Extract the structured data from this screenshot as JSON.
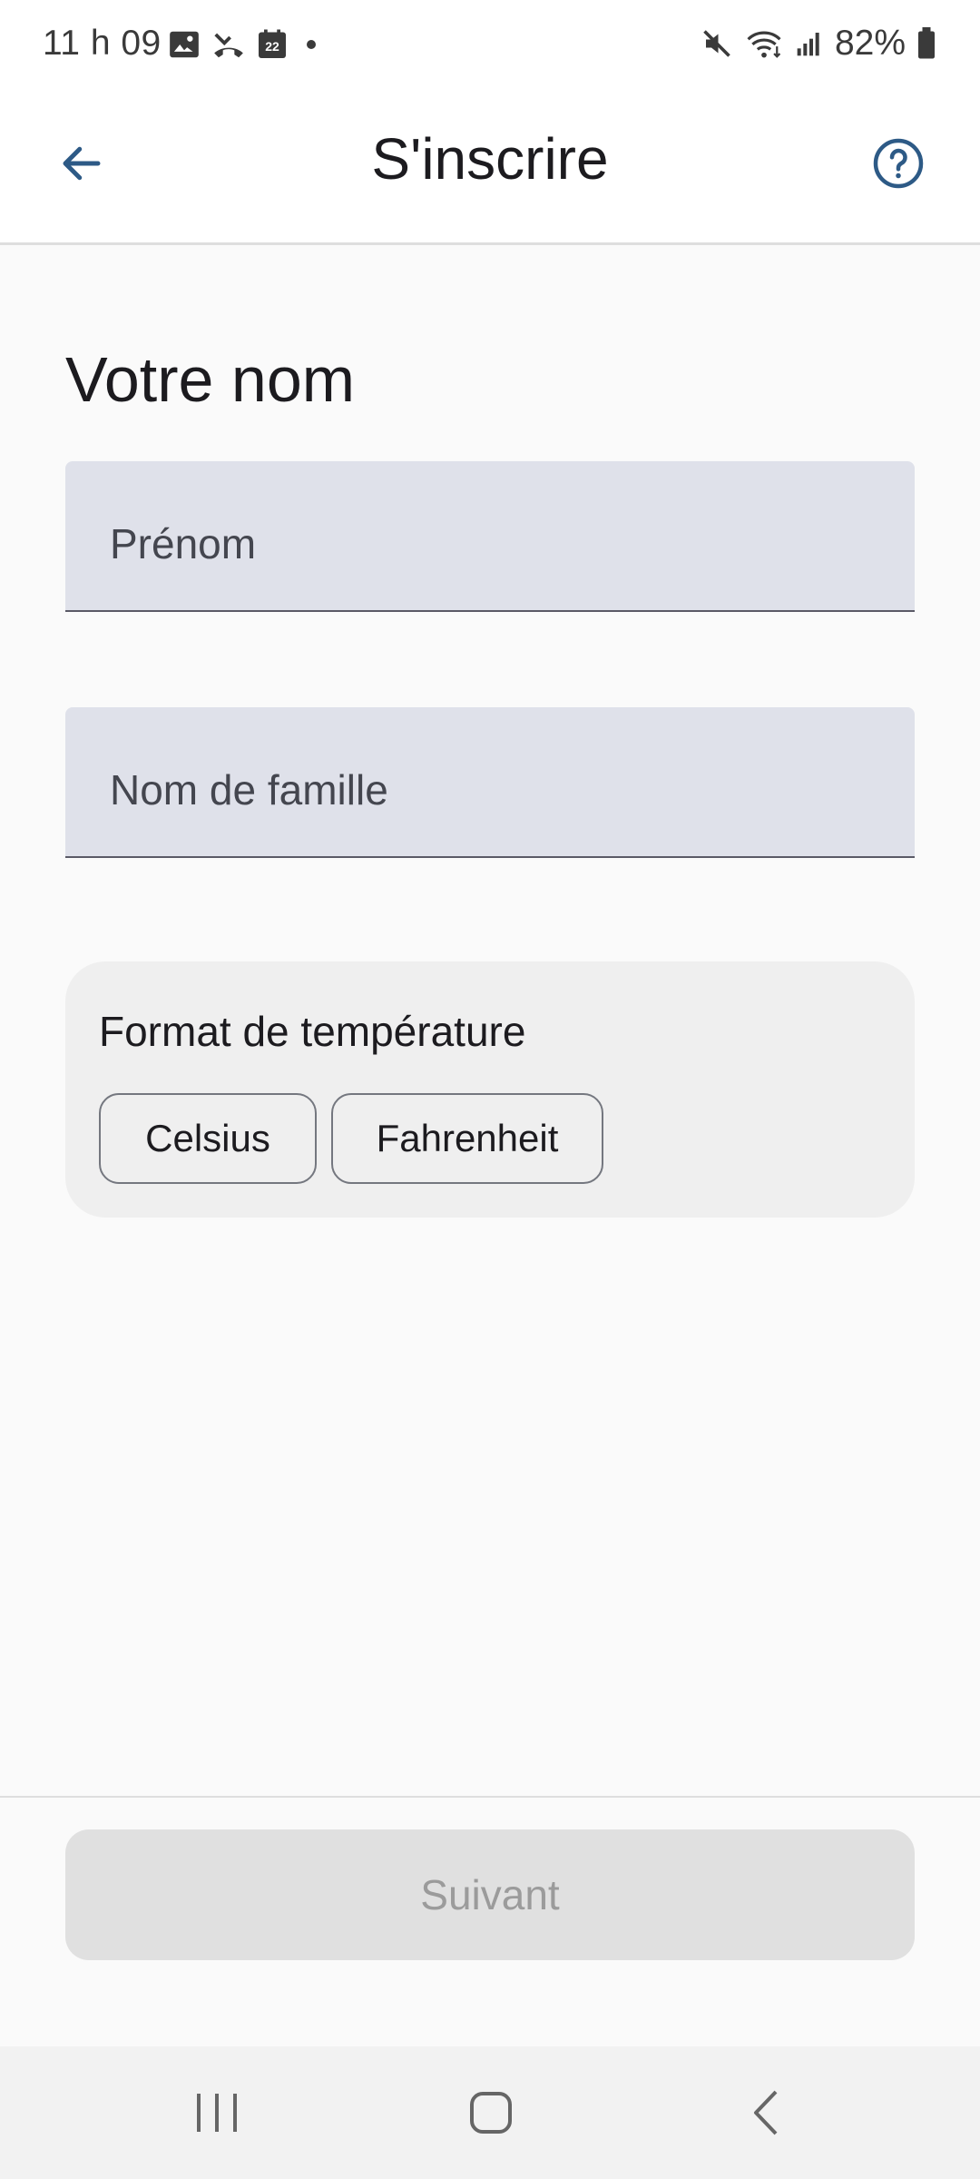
{
  "status_bar": {
    "time": "11 h 09",
    "battery": "82%",
    "calendar_day": "22",
    "icons_left": [
      "image-icon",
      "missed-call-icon",
      "calendar-icon",
      "dot-icon"
    ],
    "icons_right": [
      "mute-icon",
      "wifi-icon",
      "signal-icon",
      "battery-icon"
    ]
  },
  "app_bar": {
    "title": "S'inscrire",
    "back_icon": "arrow-back-icon",
    "help_icon": "help-icon",
    "accent_color": "#2d5a86"
  },
  "form": {
    "title": "Votre nom",
    "first_name": {
      "placeholder": "Prénom",
      "value": ""
    },
    "last_name": {
      "placeholder": "Nom de famille",
      "value": ""
    },
    "temperature": {
      "title": "Format de température",
      "options": [
        "Celsius",
        "Fahrenheit"
      ],
      "selected": null
    }
  },
  "footer": {
    "next_label": "Suivant",
    "next_enabled": false
  },
  "nav_bar": {
    "icons": [
      "recents-icon",
      "home-icon",
      "back-icon"
    ]
  }
}
